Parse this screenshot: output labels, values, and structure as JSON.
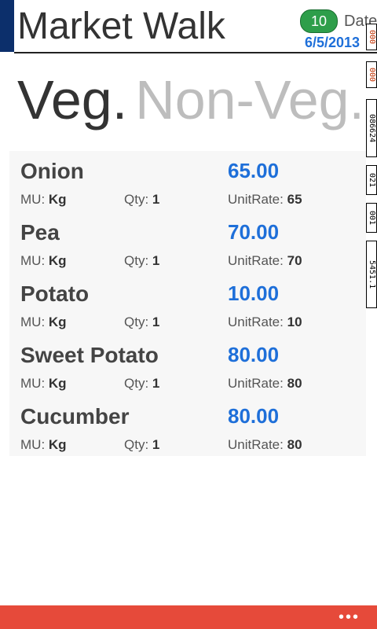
{
  "header": {
    "title": "Market Walk",
    "badge_count": "10",
    "date_label": "Date",
    "date_value": "6/5/2013"
  },
  "pivot": {
    "active": "Veg.",
    "inactive": "Non-Veg."
  },
  "labels": {
    "mu": "MU:",
    "qty": "Qty:",
    "unit_rate": "UnitRate:"
  },
  "items": [
    {
      "name": "Onion",
      "price": "65.00",
      "mu": "Kg",
      "qty": "1",
      "unit_rate": "65"
    },
    {
      "name": "Pea",
      "price": "70.00",
      "mu": "Kg",
      "qty": "1",
      "unit_rate": "70"
    },
    {
      "name": "Potato",
      "price": "10.00",
      "mu": "Kg",
      "qty": "1",
      "unit_rate": "10"
    },
    {
      "name": "Sweet Potato",
      "price": "80.00",
      "mu": "Kg",
      "qty": "1",
      "unit_rate": "80"
    },
    {
      "name": "Cucumber",
      "price": "80.00",
      "mu": "Kg",
      "qty": "1",
      "unit_rate": "80"
    }
  ],
  "debug_counters": [
    "000",
    "000",
    "086624",
    "021",
    "001",
    "5451.1"
  ],
  "appbar": {
    "more_label": "•••"
  },
  "colors": {
    "accent": "#1e6fd9",
    "appbar": "#e64a3a",
    "badge": "#2e9e4a"
  }
}
